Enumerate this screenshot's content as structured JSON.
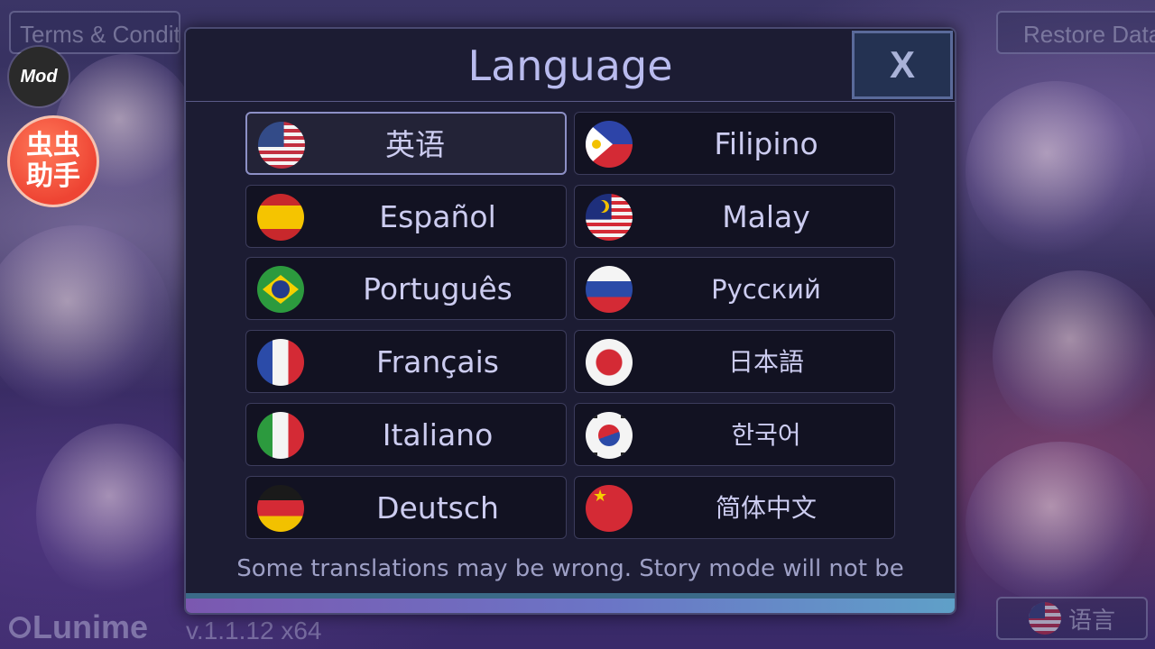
{
  "background": {
    "terms_button": "Terms & Conditions",
    "restore_button": "Restore Data",
    "mod_badge": "Mod",
    "helper_badge": "虫虫助手",
    "logo_text": "Lunime",
    "version": "v.1.1.12 x64",
    "language_button": "语言"
  },
  "dialog": {
    "title": "Language",
    "close_label": "X",
    "note": "Some translations may be wrong. Story mode will not be",
    "languages": [
      {
        "label": "英语",
        "flag": "us-flag-icon",
        "selected": true
      },
      {
        "label": "Filipino",
        "flag": "philippines-flag-icon"
      },
      {
        "label": "Español",
        "flag": "spain-flag-icon"
      },
      {
        "label": "Malay",
        "flag": "malaysia-flag-icon"
      },
      {
        "label": "Português",
        "flag": "brazil-flag-icon"
      },
      {
        "label": "Русский",
        "flag": "russia-flag-icon"
      },
      {
        "label": "Français",
        "flag": "france-flag-icon"
      },
      {
        "label": "日本語",
        "flag": "japan-flag-icon"
      },
      {
        "label": "Italiano",
        "flag": "italy-flag-icon"
      },
      {
        "label": "한국어",
        "flag": "korea-flag-icon"
      },
      {
        "label": "Deutsch",
        "flag": "germany-flag-icon"
      },
      {
        "label": "简体中文",
        "flag": "china-flag-icon"
      }
    ]
  }
}
